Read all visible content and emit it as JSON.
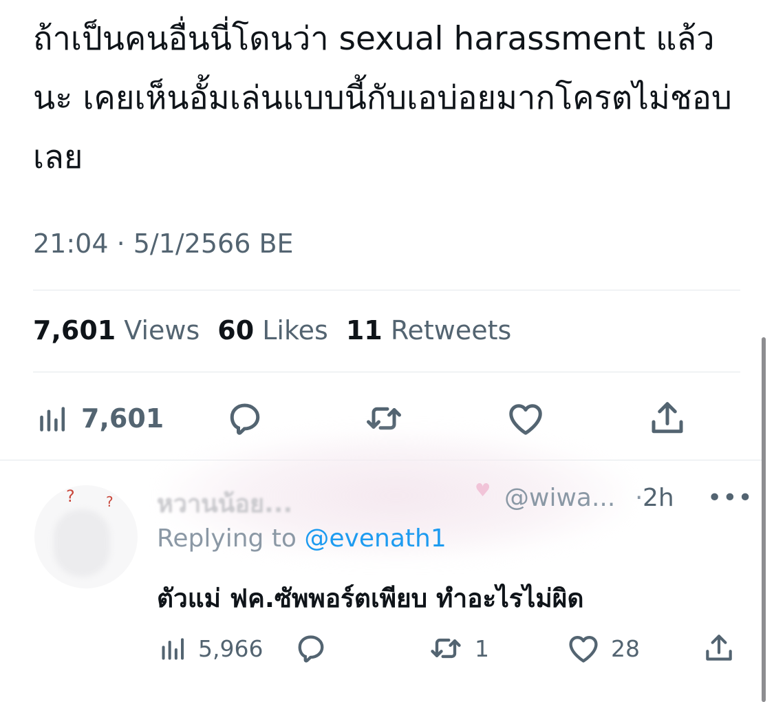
{
  "tweet": {
    "text": "ถ้าเป็นคนอื่นนี่โดนว่า sexual harassment แล้วนะ เคยเห็นอั้มเล่นแบบนี้กับเอบ่อยมากโครตไม่ชอบเลย",
    "timestamp": "21:04 · 5/1/2566 BE",
    "stats": {
      "views_count": "7,601",
      "views_label": "Views",
      "likes_count": "60",
      "likes_label": "Likes",
      "retweets_count": "11",
      "retweets_label": "Retweets"
    },
    "actions": {
      "views_count": "7,601"
    }
  },
  "reply": {
    "display_name": "หวานน้อย...",
    "handle": "@wiwa...",
    "separator": "·",
    "time": "2h",
    "more": "•••",
    "replying_to_label": "Replying to ",
    "replying_to_handle": "@evenath1",
    "text": "ตัวแม่ ฟค.ซัพพอร์ตเพียบ ทำอะไรไม่ผิด",
    "actions": {
      "views": "5,966",
      "retweets": "1",
      "likes": "28"
    }
  },
  "icons": [
    "views-icon",
    "reply-icon",
    "retweet-icon",
    "like-icon",
    "share-icon",
    "more-icon"
  ],
  "colors": {
    "primary_text": "#0f1419",
    "secondary_text": "#536471",
    "link": "#1d9bf0",
    "divider": "#e3e8eb"
  }
}
